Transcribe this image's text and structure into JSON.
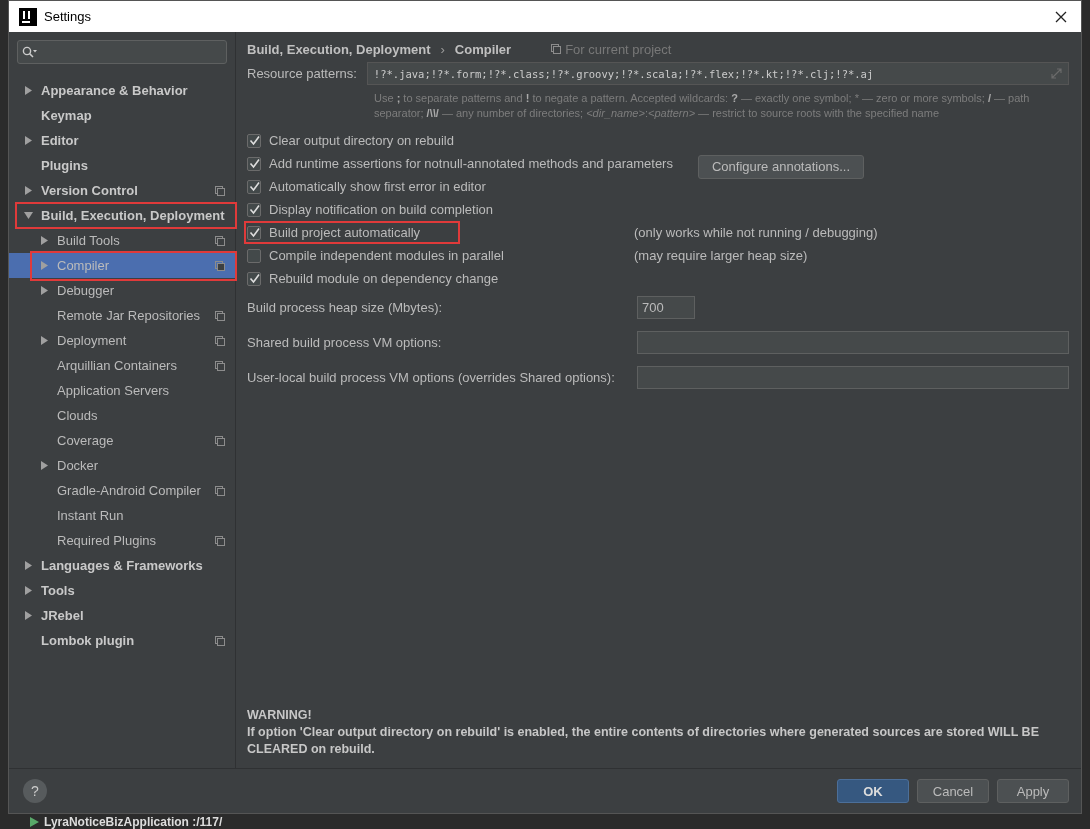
{
  "window": {
    "title": "Settings"
  },
  "sidebar": {
    "items": [
      {
        "label": "Appearance & Behavior",
        "expandable": true,
        "expanded": false,
        "selected": false,
        "project_scoped": false,
        "highlighted": false
      },
      {
        "label": "Keymap",
        "expandable": false,
        "selected": false,
        "project_scoped": false,
        "highlighted": false
      },
      {
        "label": "Editor",
        "expandable": true,
        "expanded": false,
        "selected": false,
        "project_scoped": false,
        "highlighted": false
      },
      {
        "label": "Plugins",
        "expandable": false,
        "selected": false,
        "project_scoped": false,
        "highlighted": false
      },
      {
        "label": "Version Control",
        "expandable": true,
        "expanded": false,
        "selected": false,
        "project_scoped": true,
        "highlighted": false
      },
      {
        "label": "Build, Execution, Deployment",
        "expandable": true,
        "expanded": true,
        "selected": false,
        "project_scoped": false,
        "highlighted": true,
        "children": [
          {
            "label": "Build Tools",
            "expandable": true,
            "expanded": false,
            "selected": false,
            "project_scoped": true,
            "highlighted": false
          },
          {
            "label": "Compiler",
            "expandable": true,
            "expanded": false,
            "selected": true,
            "project_scoped": true,
            "highlighted": true
          },
          {
            "label": "Debugger",
            "expandable": true,
            "expanded": false,
            "selected": false,
            "project_scoped": false,
            "highlighted": false
          },
          {
            "label": "Remote Jar Repositories",
            "expandable": false,
            "selected": false,
            "project_scoped": true,
            "highlighted": false
          },
          {
            "label": "Deployment",
            "expandable": true,
            "expanded": false,
            "selected": false,
            "project_scoped": true,
            "highlighted": false
          },
          {
            "label": "Arquillian Containers",
            "expandable": false,
            "selected": false,
            "project_scoped": true,
            "highlighted": false
          },
          {
            "label": "Application Servers",
            "expandable": false,
            "selected": false,
            "project_scoped": false,
            "highlighted": false
          },
          {
            "label": "Clouds",
            "expandable": false,
            "selected": false,
            "project_scoped": false,
            "highlighted": false
          },
          {
            "label": "Coverage",
            "expandable": false,
            "selected": false,
            "project_scoped": true,
            "highlighted": false
          },
          {
            "label": "Docker",
            "expandable": true,
            "expanded": false,
            "selected": false,
            "project_scoped": false,
            "highlighted": false
          },
          {
            "label": "Gradle-Android Compiler",
            "expandable": false,
            "selected": false,
            "project_scoped": true,
            "highlighted": false
          },
          {
            "label": "Instant Run",
            "expandable": false,
            "selected": false,
            "project_scoped": false,
            "highlighted": false
          },
          {
            "label": "Required Plugins",
            "expandable": false,
            "selected": false,
            "project_scoped": true,
            "highlighted": false
          }
        ]
      },
      {
        "label": "Languages & Frameworks",
        "expandable": true,
        "expanded": false,
        "selected": false,
        "project_scoped": false,
        "highlighted": false
      },
      {
        "label": "Tools",
        "expandable": true,
        "expanded": false,
        "selected": false,
        "project_scoped": false,
        "highlighted": false
      },
      {
        "label": "JRebel",
        "expandable": true,
        "expanded": false,
        "selected": false,
        "project_scoped": false,
        "highlighted": false
      },
      {
        "label": "Lombok plugin",
        "expandable": false,
        "selected": false,
        "project_scoped": true,
        "highlighted": false
      }
    ]
  },
  "breadcrumb": {
    "parent": "Build, Execution, Deployment",
    "separator": "›",
    "current": "Compiler",
    "scope": "For current project"
  },
  "resource_patterns": {
    "label": "Resource patterns:",
    "value": "!?*.java;!?*.form;!?*.class;!?*.groovy;!?*.scala;!?*.flex;!?*.kt;!?*.clj;!?*.aj",
    "hint": "Use **;** to separate patterns and **!** to negate a pattern. Accepted wildcards: **?** — exactly one symbol; * — zero or more symbols; **/** — path separator; **/\\*\\*/** — any number of directories; *<dir_name>*:*<pattern>* — restrict to source roots with the specified name"
  },
  "options": [
    {
      "label": "Clear output directory on rebuild",
      "checked": true,
      "highlighted": false
    },
    {
      "label": "Add runtime assertions for notnull-annotated methods and parameters",
      "checked": true,
      "highlighted": false,
      "button": "Configure annotations..."
    },
    {
      "label": "Automatically show first error in editor",
      "checked": true,
      "highlighted": false
    },
    {
      "label": "Display notification on build completion",
      "checked": true,
      "highlighted": false
    },
    {
      "label": "Build project automatically",
      "checked": true,
      "highlighted": true,
      "note": "(only works while not running / debugging)"
    },
    {
      "label": "Compile independent modules in parallel",
      "checked": false,
      "highlighted": false,
      "note": "(may require larger heap size)"
    },
    {
      "label": "Rebuild module on dependency change",
      "checked": true,
      "highlighted": false
    }
  ],
  "fields": [
    {
      "kind": "short",
      "label": "Build process heap size (Mbytes):",
      "value": "700"
    },
    {
      "kind": "wide",
      "label": "Shared build process VM options:"
    },
    {
      "kind": "wide",
      "label": "User-local build process VM options (overrides Shared options):"
    }
  ],
  "warning": {
    "title": "WARNING!",
    "text": "If option 'Clear output directory on rebuild' is enabled, the entire contents of directories where generated sources are stored WILL BE CLEARED on rebuild."
  },
  "footer": {
    "help": "?",
    "buttons": [
      {
        "label": "OK",
        "default": true
      },
      {
        "label": "Cancel",
        "default": false
      },
      {
        "label": "Apply",
        "default": false
      }
    ]
  },
  "background": {
    "run_config": "LyraNoticeBizApplication :/117/"
  }
}
